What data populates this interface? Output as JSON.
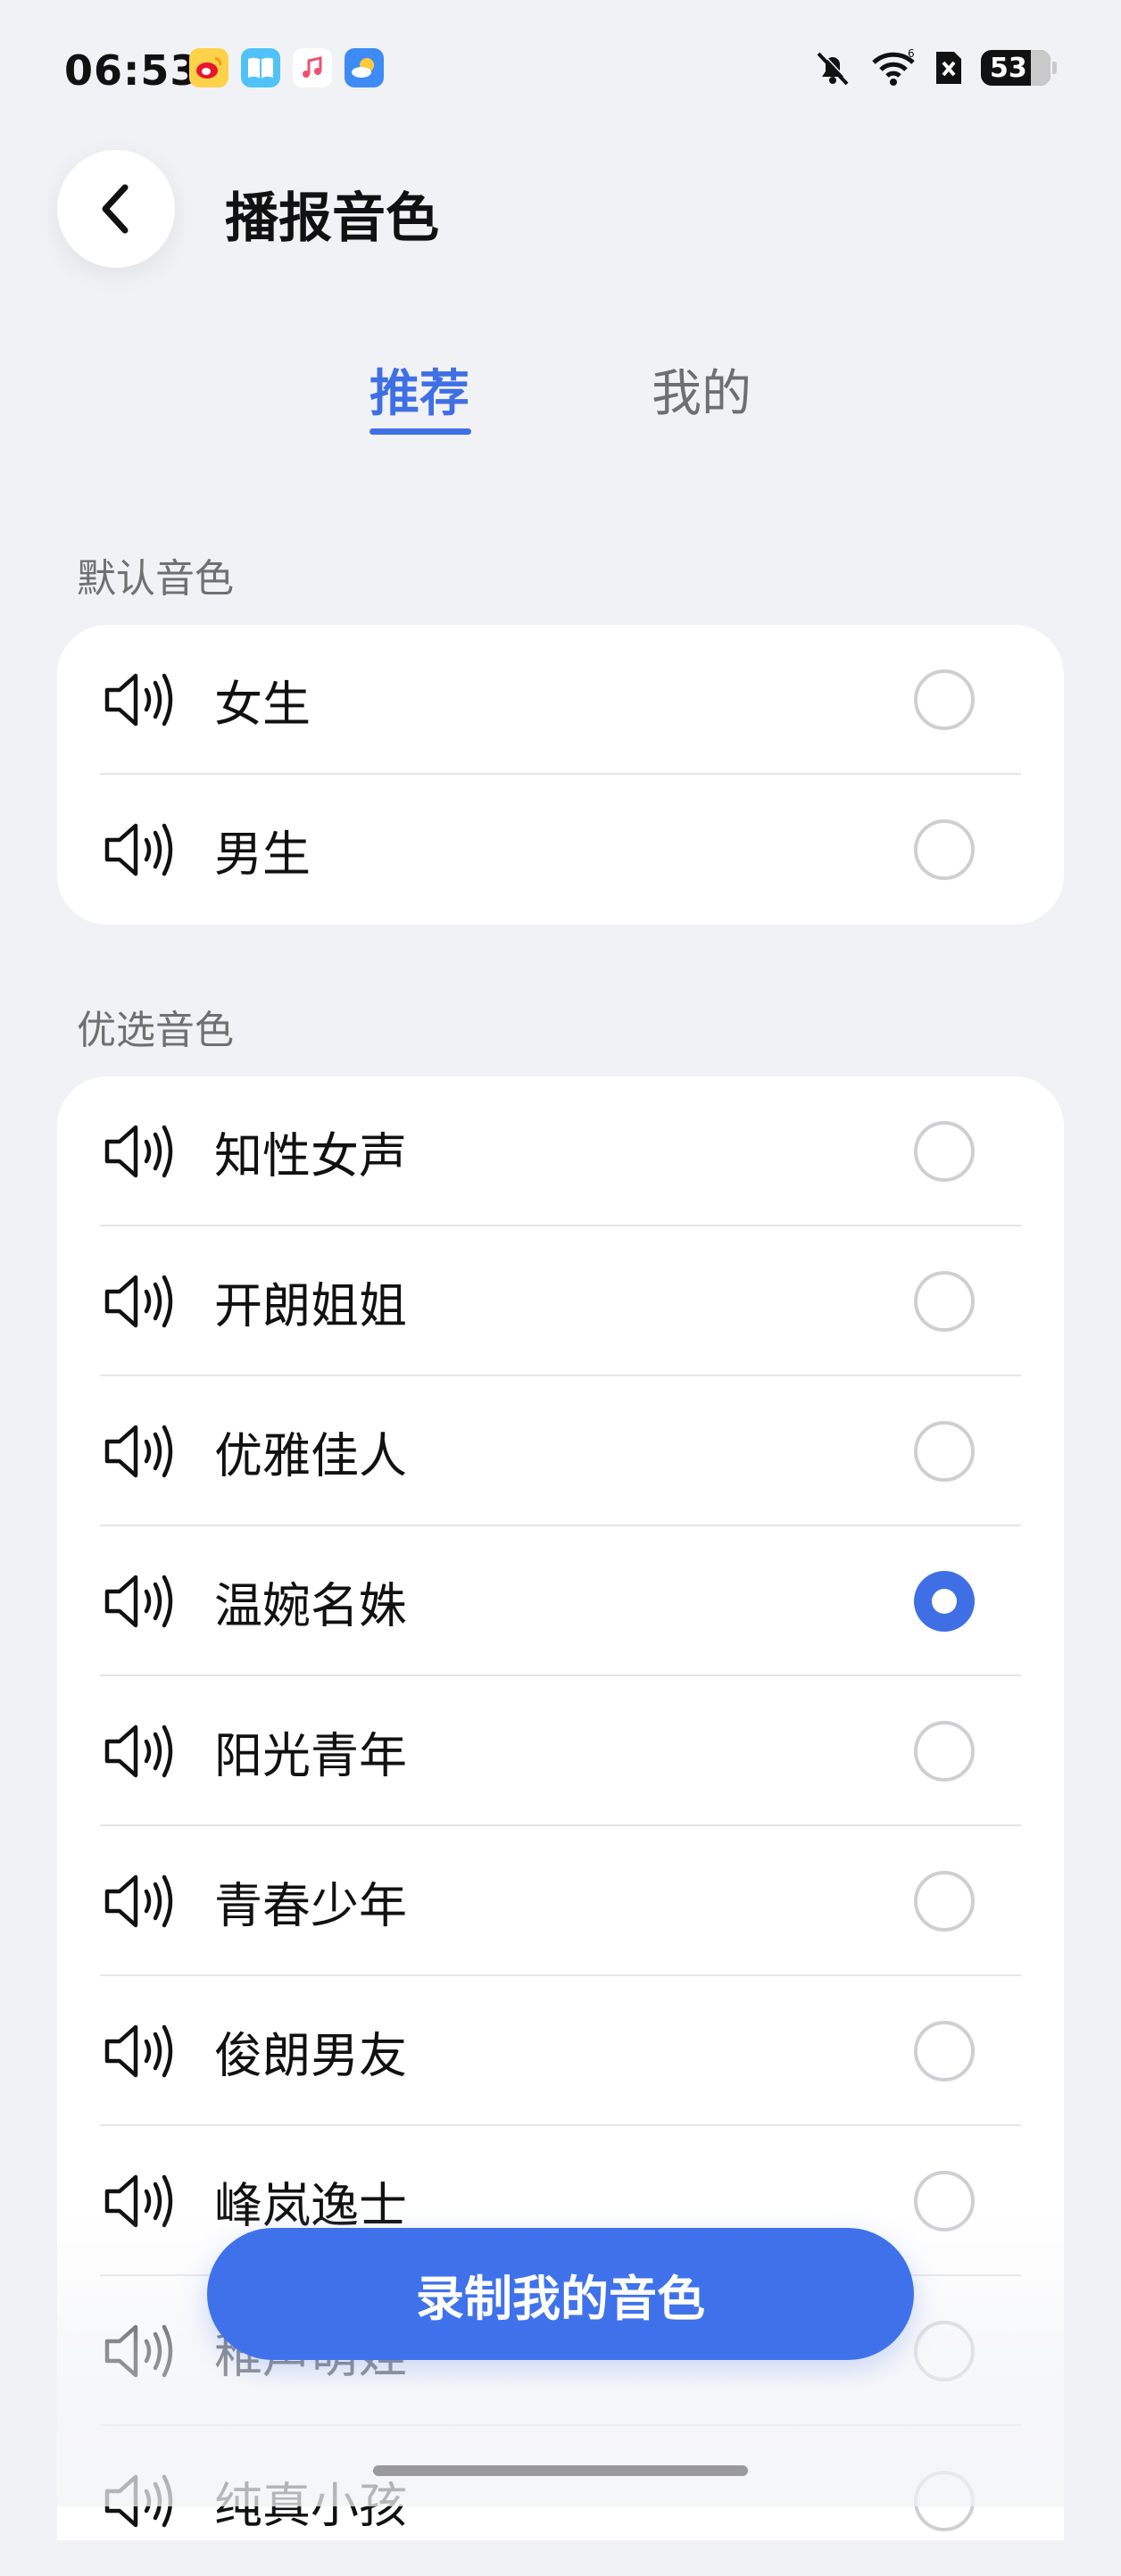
{
  "status_bar": {
    "time": "06:53",
    "battery": "53",
    "app_icons": [
      "weibo-icon",
      "book-icon",
      "music-icon",
      "weather-icon"
    ],
    "system_icons": [
      "bell-off-icon",
      "wifi-icon",
      "sim-off-icon",
      "battery-icon"
    ]
  },
  "header": {
    "title": "播报音色"
  },
  "tabs": [
    {
      "label": "推荐",
      "active": true
    },
    {
      "label": "我的",
      "active": false
    }
  ],
  "sections": [
    {
      "label": "默认音色",
      "items": [
        {
          "name": "女生",
          "selected": false
        },
        {
          "name": "男生",
          "selected": false
        }
      ]
    },
    {
      "label": "优选音色",
      "items": [
        {
          "name": "知性女声",
          "selected": false
        },
        {
          "name": "开朗姐姐",
          "selected": false
        },
        {
          "name": "优雅佳人",
          "selected": false
        },
        {
          "name": "温婉名姝",
          "selected": true
        },
        {
          "name": "阳光青年",
          "selected": false
        },
        {
          "name": "青春少年",
          "selected": false
        },
        {
          "name": "俊朗男友",
          "selected": false
        },
        {
          "name": "峰岚逸士",
          "selected": false
        },
        {
          "name": "稚声萌娃",
          "selected": false
        },
        {
          "name": "纯真小孩",
          "selected": false
        }
      ]
    }
  ],
  "record_button": {
    "label": "录制我的音色"
  },
  "colors": {
    "accent": "#3f6fe4",
    "background": "#f1f2f6"
  }
}
